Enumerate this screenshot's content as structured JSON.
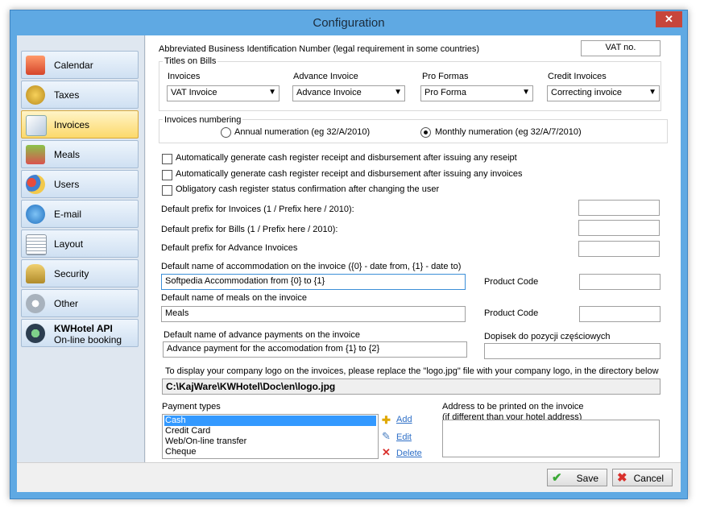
{
  "window": {
    "title": "Configuration",
    "close_glyph": "✕"
  },
  "sidebar": {
    "items": [
      {
        "label": "Calendar",
        "icon": "calendar-icon"
      },
      {
        "label": "Taxes",
        "icon": "coins-icon"
      },
      {
        "label": "Invoices",
        "icon": "invoice-icon"
      },
      {
        "label": "Meals",
        "icon": "meals-icon"
      },
      {
        "label": "Users",
        "icon": "users-icon"
      },
      {
        "label": "E-mail",
        "icon": "email-icon"
      },
      {
        "label": "Layout",
        "icon": "layout-icon"
      },
      {
        "label": "Security",
        "icon": "lock-icon"
      },
      {
        "label": "Other",
        "icon": "gear-icon"
      }
    ],
    "api": {
      "title": "KWHotel API",
      "subtitle": "On-line booking",
      "icon": "api-icon"
    },
    "active": "Invoices"
  },
  "invoices": {
    "business_id_label": "Abbreviated Business Identification Number (legal requirement in some countries)",
    "business_id_value": "VAT no.",
    "titles_on_bills": {
      "legend": "Titles on Bills",
      "fields": [
        {
          "label": "Invoices",
          "value": "VAT Invoice"
        },
        {
          "label": "Advance Invoice",
          "value": "Advance Invoice"
        },
        {
          "label": "Pro Formas",
          "value": "Pro Forma"
        },
        {
          "label": "Credit Invoices",
          "value": "Correcting invoice"
        }
      ]
    },
    "numbering": {
      "legend": "Invoices numbering",
      "annual": "Annual numeration (eg 32/A/2010)",
      "monthly": "Monthly numeration (eg 32/A/7/2010)",
      "selected": "monthly"
    },
    "checkboxes": [
      {
        "label": "Automatically generate cash register receipt and disbursement after issuing any reseipt",
        "checked": false
      },
      {
        "label": "Automatically generate cash register receipt and disbursement after issuing any invoices",
        "checked": false
      },
      {
        "label": "Obligatory cash register status confirmation after changing the user",
        "checked": false
      }
    ],
    "prefix_invoices_label": "Default prefix for Invoices (1 / Prefix here / 2010):",
    "prefix_bills_label": "Default prefix for Bills (1 /  Prefix here / 2010):",
    "prefix_advance_label": "Default prefix for Advance Invoices",
    "accommodation_label": "Default name of accommodation on the invoice ({0} - date from, {1} - date to)",
    "accommodation_value": "Softpedia Accommodation from {0} to {1}",
    "meals_label": "Default name of meals on the invoice",
    "meals_value": "Meals",
    "product_code_label": "Product Code",
    "advance_label": "Default name of advance payments on the invoice",
    "advance_value": "Advance payment for the accomodation from {1} to {2}",
    "dopisek_label": "Dopisek do pozycji częściowych",
    "logo_note": "To display your company logo on the invoices, please replace the \"logo.jpg\" file with your company logo, in the directory below",
    "logo_path": "C:\\KajWare\\KWHotel\\Doc\\en\\logo.jpg",
    "payment_types_label": "Payment types",
    "payment_types": [
      "Cash",
      "Credit Card",
      "Web/On-line transfer",
      "Cheque"
    ],
    "payment_selected": "Cash",
    "add_label": "Add",
    "edit_label": "Edit",
    "delete_label": "Delete",
    "address_label_1": "Address to be printed on the invoice",
    "address_label_2": "(if different than your hotel address)"
  },
  "footer": {
    "save_label": "Save",
    "cancel_label": "Cancel"
  }
}
